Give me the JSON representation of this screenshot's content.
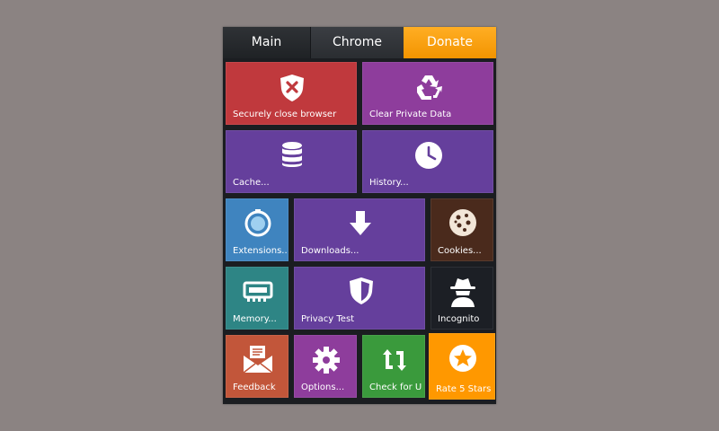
{
  "tabs": [
    {
      "label": "Main"
    },
    {
      "label": "Chrome"
    },
    {
      "label": "Donate"
    }
  ],
  "tiles": {
    "close_browser": {
      "label": "Securely close browser",
      "color": "#c0393d",
      "icon": "shield-x-icon"
    },
    "clear_data": {
      "label": "Clear Private Data",
      "color": "#8e3d9c",
      "icon": "recycle-icon"
    },
    "cache": {
      "label": "Cache...",
      "color": "#653f9c",
      "icon": "database-icon"
    },
    "history": {
      "label": "History...",
      "color": "#653f9c",
      "icon": "clock-icon"
    },
    "extensions": {
      "label": "Extensions...",
      "color": "#3f84bf",
      "icon": "extension-icon"
    },
    "downloads": {
      "label": "Downloads...",
      "color": "#653f9c",
      "icon": "download-arrow-icon"
    },
    "cookies": {
      "label": "Cookies...",
      "color": "#4a2a1c",
      "icon": "cookie-icon"
    },
    "memory": {
      "label": "Memory...",
      "color": "#2e8585",
      "icon": "memory-chip-icon"
    },
    "privacy_test": {
      "label": "Privacy Test",
      "color": "#653f9c",
      "icon": "shield-icon"
    },
    "incognito": {
      "label": "Incognito",
      "color": "#1c1f25",
      "icon": "incognito-spy-icon"
    },
    "feedback": {
      "label": "Feedback",
      "color": "#c2563a",
      "icon": "mail-envelope-icon"
    },
    "options": {
      "label": "Options...",
      "color": "#8e3d9c",
      "icon": "gear-icon"
    },
    "check_updates": {
      "label": "Check for U",
      "color": "#3a9a3c",
      "icon": "refresh-arrows-icon"
    },
    "rate": {
      "label": "Rate 5 Stars",
      "color": "#ff9800",
      "icon": "star-badge-icon"
    }
  }
}
